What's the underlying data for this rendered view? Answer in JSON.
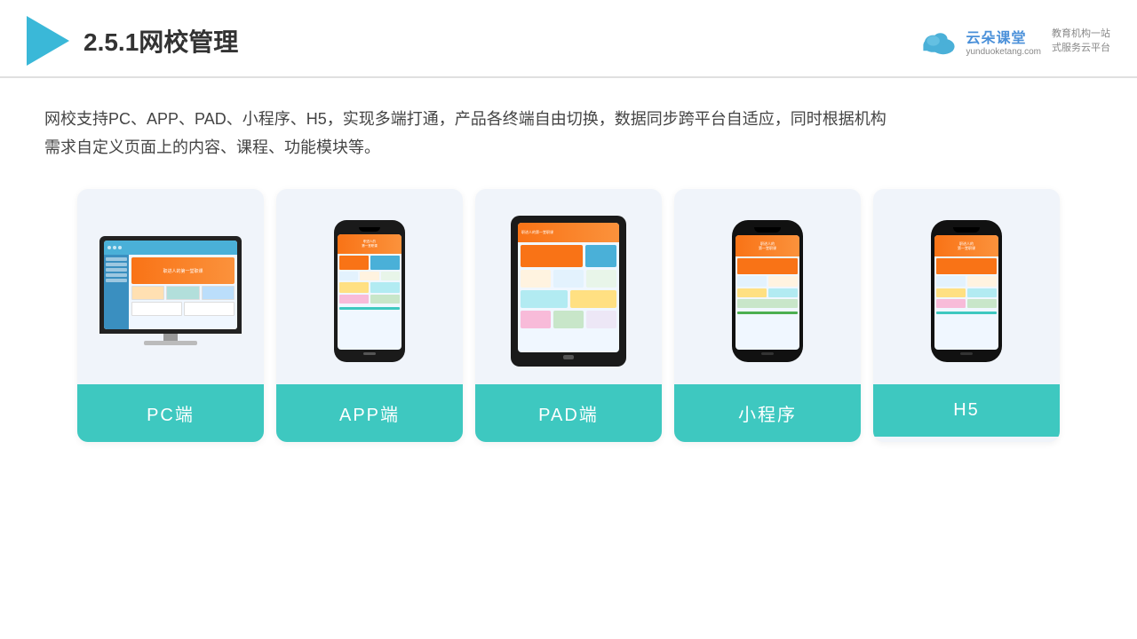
{
  "header": {
    "title": "2.5.1网校管理",
    "brand": {
      "name": "云朵课堂",
      "url": "yunduoketang.com",
      "slogan": "教育机构一站\n式服务云平台"
    }
  },
  "description": "网校支持PC、APP、PAD、小程序、H5，实现多端打通，产品各终端自由切换，数据同步跨平台自适应，同时根据机构\n需求自定义页面上的内容、课程、功能模块等。",
  "cards": [
    {
      "id": "pc",
      "label": "PC端",
      "device": "pc"
    },
    {
      "id": "app",
      "label": "APP端",
      "device": "phone"
    },
    {
      "id": "pad",
      "label": "PAD端",
      "device": "tablet"
    },
    {
      "id": "mini",
      "label": "小程序",
      "device": "phone2"
    },
    {
      "id": "h5",
      "label": "H5",
      "device": "phone3"
    }
  ],
  "colors": {
    "teal": "#3ec8c0",
    "blue": "#4ab0d8",
    "orange": "#f97316",
    "accent": "#3ab8d8"
  }
}
